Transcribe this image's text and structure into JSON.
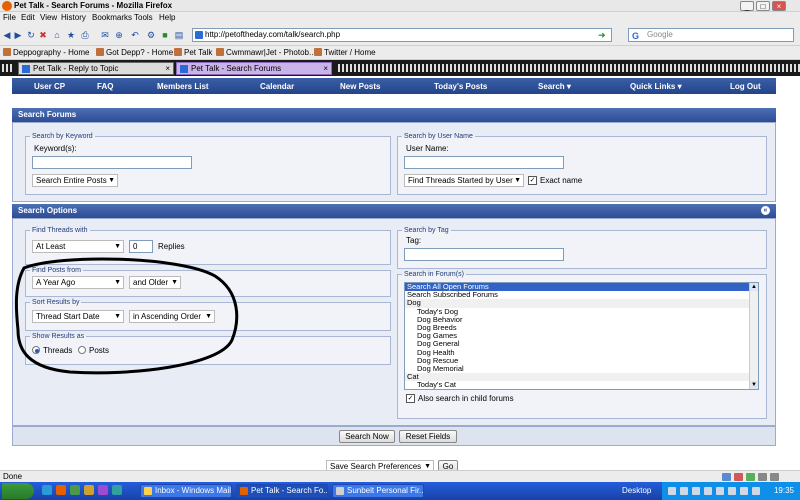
{
  "window": {
    "title": "Pet Talk - Search Forums - Mozilla Firefox"
  },
  "menu": [
    "File",
    "Edit",
    "View",
    "History",
    "Bookmarks",
    "Tools",
    "Help"
  ],
  "address": {
    "url": "http://petoftheday.com/talk/search.php"
  },
  "search_engine": {
    "placeholder": "Google"
  },
  "bookmarks": [
    "Deppography - Home",
    "Got Depp? - Home",
    "Pet Talk",
    "Cwmmawr|Jet - Photob...",
    "Twitter / Home"
  ],
  "tabs": [
    {
      "label": "Pet Talk - Reply to Topic",
      "active": false
    },
    {
      "label": "Pet Talk - Search Forums",
      "active": true
    }
  ],
  "sitenav": [
    "User CP",
    "FAQ",
    "Members List",
    "Calendar",
    "New Posts",
    "Today's Posts",
    "Search ▾",
    "Quick Links ▾",
    "Log Out"
  ],
  "search_forums": {
    "title": "Search Forums",
    "by_keyword": {
      "legend": "Search by Keyword",
      "label": "Keyword(s):",
      "scope": "Search Entire Posts"
    },
    "by_user": {
      "legend": "Search by User Name",
      "label": "User Name:",
      "mode": "Find Threads Started by User",
      "exact_label": "Exact name",
      "exact_checked": true
    }
  },
  "search_options": {
    "title": "Search Options",
    "find_threads": {
      "legend": "Find Threads with",
      "qualifier": "At Least",
      "count": "0",
      "unit": "Replies"
    },
    "find_posts": {
      "legend": "Find Posts from",
      "age": "A Year Ago",
      "direction": "and Older"
    },
    "sort": {
      "legend": "Sort Results by",
      "field": "Thread Start Date",
      "order": "in Ascending Order"
    },
    "show_as": {
      "legend": "Show Results as",
      "threads": "Threads",
      "posts": "Posts",
      "selected": "Threads"
    },
    "by_tag": {
      "legend": "Search by Tag",
      "label": "Tag:"
    },
    "in_forums": {
      "legend": "Search in Forum(s)",
      "items": [
        {
          "label": "Search All Open Forums",
          "kind": "selected"
        },
        {
          "label": "Search Subscribed Forums",
          "kind": "normal"
        },
        {
          "label": "Dog",
          "kind": "group"
        },
        {
          "label": "Today's Dog",
          "kind": "sub"
        },
        {
          "label": "Dog Behavior",
          "kind": "sub"
        },
        {
          "label": "Dog Breeds",
          "kind": "sub"
        },
        {
          "label": "Dog Games",
          "kind": "sub"
        },
        {
          "label": "Dog General",
          "kind": "sub"
        },
        {
          "label": "Dog Health",
          "kind": "sub"
        },
        {
          "label": "Dog Rescue",
          "kind": "sub"
        },
        {
          "label": "Dog Memorial",
          "kind": "sub"
        },
        {
          "label": "Cat",
          "kind": "group"
        },
        {
          "label": "Today's Cat",
          "kind": "sub"
        }
      ],
      "child_label": "Also search in child forums",
      "child_checked": true
    }
  },
  "actions": {
    "search": "Search Now",
    "reset": "Reset Fields"
  },
  "prefs": {
    "select": "Save Search Preferences",
    "go": "Go"
  },
  "status": {
    "text": "Done"
  },
  "taskbar": {
    "tasks": [
      "Inbox - Windows Mail",
      "Pet Talk - Search Fo...",
      "Sunbelt Personal Fir..."
    ],
    "desktop": "Desktop",
    "clock": "19:35"
  }
}
